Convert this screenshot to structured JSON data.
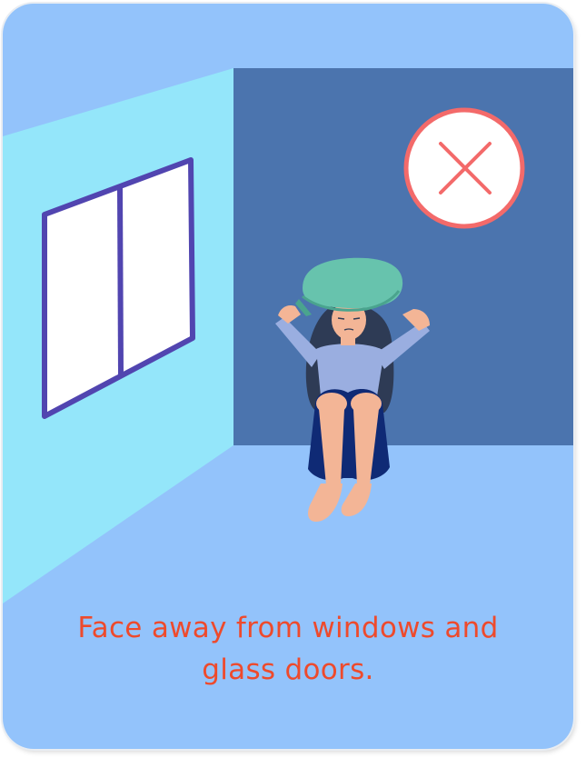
{
  "card": {
    "caption_line_1": "Face away from windows and",
    "caption_line_2": "glass doors."
  },
  "icons": {
    "prohibited": "close-x-icon"
  },
  "colors": {
    "card_background": "#93c3fb",
    "back_wall": "#4b74ae",
    "side_wall": "#94e6fa",
    "window_frame": "#5145b0",
    "window_glass": "#ffffff",
    "prohibited_ring": "#f36a6a",
    "caption_text": "#ee4a2c"
  }
}
